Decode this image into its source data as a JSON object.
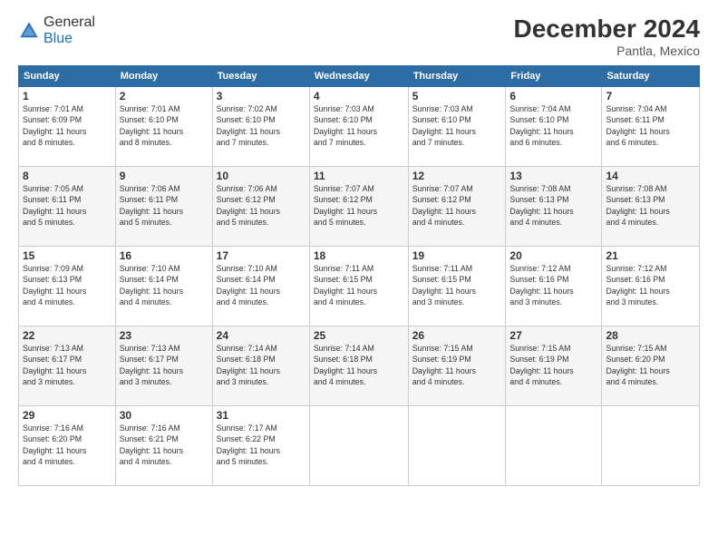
{
  "logo": {
    "general": "General",
    "blue": "Blue"
  },
  "header": {
    "month": "December 2024",
    "location": "Pantla, Mexico"
  },
  "weekdays": [
    "Sunday",
    "Monday",
    "Tuesday",
    "Wednesday",
    "Thursday",
    "Friday",
    "Saturday"
  ],
  "weeks": [
    [
      {
        "day": "1",
        "info": "Sunrise: 7:01 AM\nSunset: 6:09 PM\nDaylight: 11 hours\nand 8 minutes."
      },
      {
        "day": "2",
        "info": "Sunrise: 7:01 AM\nSunset: 6:10 PM\nDaylight: 11 hours\nand 8 minutes."
      },
      {
        "day": "3",
        "info": "Sunrise: 7:02 AM\nSunset: 6:10 PM\nDaylight: 11 hours\nand 7 minutes."
      },
      {
        "day": "4",
        "info": "Sunrise: 7:03 AM\nSunset: 6:10 PM\nDaylight: 11 hours\nand 7 minutes."
      },
      {
        "day": "5",
        "info": "Sunrise: 7:03 AM\nSunset: 6:10 PM\nDaylight: 11 hours\nand 7 minutes."
      },
      {
        "day": "6",
        "info": "Sunrise: 7:04 AM\nSunset: 6:10 PM\nDaylight: 11 hours\nand 6 minutes."
      },
      {
        "day": "7",
        "info": "Sunrise: 7:04 AM\nSunset: 6:11 PM\nDaylight: 11 hours\nand 6 minutes."
      }
    ],
    [
      {
        "day": "8",
        "info": "Sunrise: 7:05 AM\nSunset: 6:11 PM\nDaylight: 11 hours\nand 5 minutes."
      },
      {
        "day": "9",
        "info": "Sunrise: 7:06 AM\nSunset: 6:11 PM\nDaylight: 11 hours\nand 5 minutes."
      },
      {
        "day": "10",
        "info": "Sunrise: 7:06 AM\nSunset: 6:12 PM\nDaylight: 11 hours\nand 5 minutes."
      },
      {
        "day": "11",
        "info": "Sunrise: 7:07 AM\nSunset: 6:12 PM\nDaylight: 11 hours\nand 5 minutes."
      },
      {
        "day": "12",
        "info": "Sunrise: 7:07 AM\nSunset: 6:12 PM\nDaylight: 11 hours\nand 4 minutes."
      },
      {
        "day": "13",
        "info": "Sunrise: 7:08 AM\nSunset: 6:13 PM\nDaylight: 11 hours\nand 4 minutes."
      },
      {
        "day": "14",
        "info": "Sunrise: 7:08 AM\nSunset: 6:13 PM\nDaylight: 11 hours\nand 4 minutes."
      }
    ],
    [
      {
        "day": "15",
        "info": "Sunrise: 7:09 AM\nSunset: 6:13 PM\nDaylight: 11 hours\nand 4 minutes."
      },
      {
        "day": "16",
        "info": "Sunrise: 7:10 AM\nSunset: 6:14 PM\nDaylight: 11 hours\nand 4 minutes."
      },
      {
        "day": "17",
        "info": "Sunrise: 7:10 AM\nSunset: 6:14 PM\nDaylight: 11 hours\nand 4 minutes."
      },
      {
        "day": "18",
        "info": "Sunrise: 7:11 AM\nSunset: 6:15 PM\nDaylight: 11 hours\nand 4 minutes."
      },
      {
        "day": "19",
        "info": "Sunrise: 7:11 AM\nSunset: 6:15 PM\nDaylight: 11 hours\nand 3 minutes."
      },
      {
        "day": "20",
        "info": "Sunrise: 7:12 AM\nSunset: 6:16 PM\nDaylight: 11 hours\nand 3 minutes."
      },
      {
        "day": "21",
        "info": "Sunrise: 7:12 AM\nSunset: 6:16 PM\nDaylight: 11 hours\nand 3 minutes."
      }
    ],
    [
      {
        "day": "22",
        "info": "Sunrise: 7:13 AM\nSunset: 6:17 PM\nDaylight: 11 hours\nand 3 minutes."
      },
      {
        "day": "23",
        "info": "Sunrise: 7:13 AM\nSunset: 6:17 PM\nDaylight: 11 hours\nand 3 minutes."
      },
      {
        "day": "24",
        "info": "Sunrise: 7:14 AM\nSunset: 6:18 PM\nDaylight: 11 hours\nand 3 minutes."
      },
      {
        "day": "25",
        "info": "Sunrise: 7:14 AM\nSunset: 6:18 PM\nDaylight: 11 hours\nand 4 minutes."
      },
      {
        "day": "26",
        "info": "Sunrise: 7:15 AM\nSunset: 6:19 PM\nDaylight: 11 hours\nand 4 minutes."
      },
      {
        "day": "27",
        "info": "Sunrise: 7:15 AM\nSunset: 6:19 PM\nDaylight: 11 hours\nand 4 minutes."
      },
      {
        "day": "28",
        "info": "Sunrise: 7:15 AM\nSunset: 6:20 PM\nDaylight: 11 hours\nand 4 minutes."
      }
    ],
    [
      {
        "day": "29",
        "info": "Sunrise: 7:16 AM\nSunset: 6:20 PM\nDaylight: 11 hours\nand 4 minutes."
      },
      {
        "day": "30",
        "info": "Sunrise: 7:16 AM\nSunset: 6:21 PM\nDaylight: 11 hours\nand 4 minutes."
      },
      {
        "day": "31",
        "info": "Sunrise: 7:17 AM\nSunset: 6:22 PM\nDaylight: 11 hours\nand 5 minutes."
      },
      null,
      null,
      null,
      null
    ]
  ]
}
